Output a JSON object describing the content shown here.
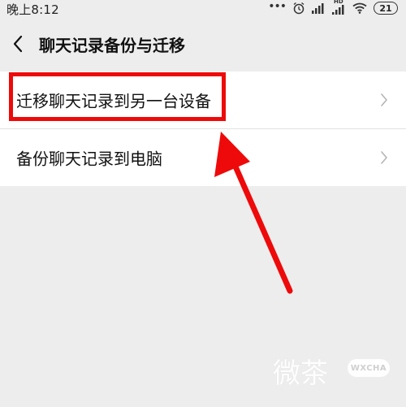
{
  "status_bar": {
    "time": "晚上8:12",
    "battery": "21",
    "signal_label": "HD",
    "icons": [
      "dots-icon",
      "alarm-icon",
      "signal-icon",
      "hd-signal-icon",
      "wifi-icon",
      "battery-icon"
    ]
  },
  "header": {
    "title": "聊天记录备份与迁移",
    "back_icon": "chevron-left-icon"
  },
  "list": {
    "items": [
      {
        "label": "迁移聊天记录到另一台设备",
        "icon": "chevron-right-icon"
      },
      {
        "label": "备份聊天记录到电脑",
        "icon": "chevron-right-icon"
      }
    ]
  },
  "annotation": {
    "highlight_color": "#ee0a0a",
    "arrow_color": "#ee0a0a"
  },
  "watermark": {
    "text": "微茶",
    "badge": "WXCHA"
  },
  "colors": {
    "background": "#ededed",
    "panel": "#ffffff",
    "text": "#111111",
    "annotation": "#ee0a0a"
  }
}
